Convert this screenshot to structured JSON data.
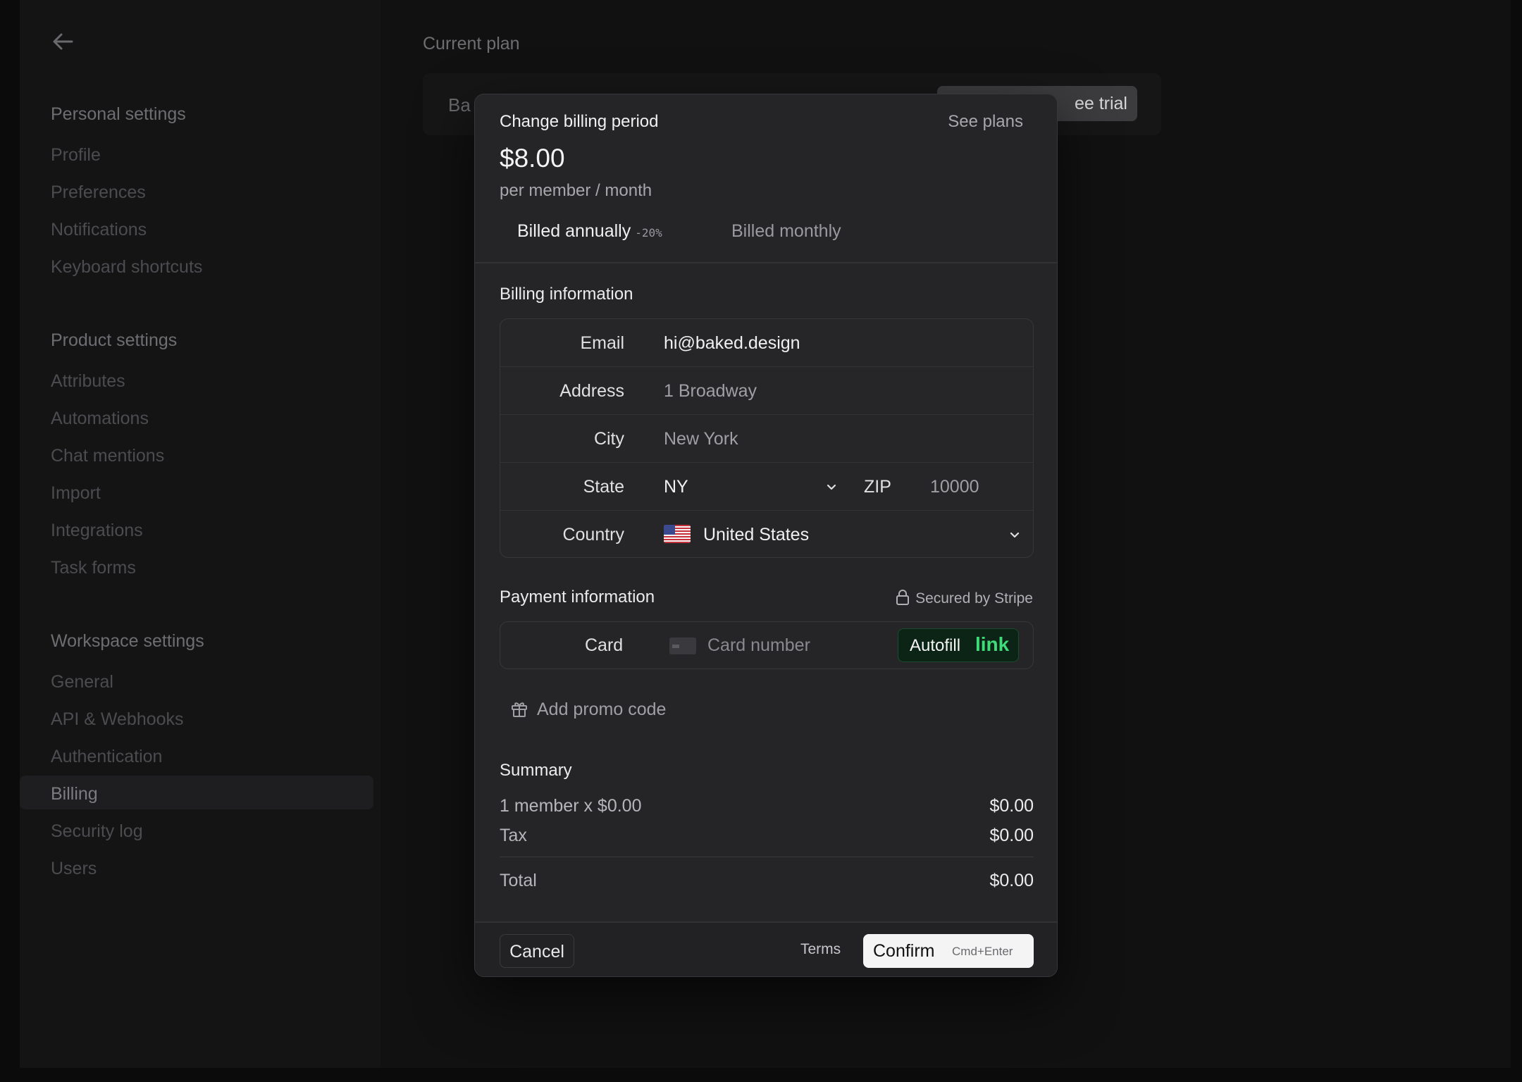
{
  "sidebar": {
    "personal_heading": "Personal settings",
    "personal_items": [
      "Profile",
      "Preferences",
      "Notifications",
      "Keyboard shortcuts"
    ],
    "product_heading": "Product settings",
    "product_items": [
      "Attributes",
      "Automations",
      "Chat mentions",
      "Import",
      "Integrations",
      "Task forms"
    ],
    "workspace_heading": "Workspace settings",
    "workspace_items": [
      "General",
      "API & Webhooks",
      "Authentication",
      "Billing",
      "Security log",
      "Users"
    ],
    "active_item": "Billing"
  },
  "main": {
    "heading": "Current plan",
    "plan_name_partial": "Ba",
    "trial_button_partial": "ee trial"
  },
  "modal": {
    "title": "Change billing period",
    "see_plans": "See plans",
    "price": "$8.00",
    "per": "per member / month",
    "billed_annually": "Billed annually",
    "discount": "-20%",
    "billed_monthly": "Billed monthly",
    "billing_title": "Billing information",
    "fields": {
      "email_label": "Email",
      "email_value": "hi@baked.design",
      "address_label": "Address",
      "address_placeholder": "1 Broadway",
      "city_label": "City",
      "city_placeholder": "New York",
      "state_label": "State",
      "state_value": "NY",
      "zip_label": "ZIP",
      "zip_placeholder": "10000",
      "country_label": "Country",
      "country_value": "United States"
    },
    "payment_title": "Payment information",
    "secured": "Secured by Stripe",
    "card_label": "Card",
    "card_placeholder": "Card number",
    "autofill": "Autofill",
    "autofill_link": "link",
    "promo": "Add promo code",
    "summary_title": "Summary",
    "summary_rows": [
      {
        "label": "1 member x $0.00",
        "amount": "$0.00"
      },
      {
        "label": "Tax",
        "amount": "$0.00"
      }
    ],
    "total_label": "Total",
    "total_amount": "$0.00",
    "cancel": "Cancel",
    "terms": "Terms",
    "confirm": "Confirm",
    "confirm_shortcut": "Cmd+Enter"
  }
}
